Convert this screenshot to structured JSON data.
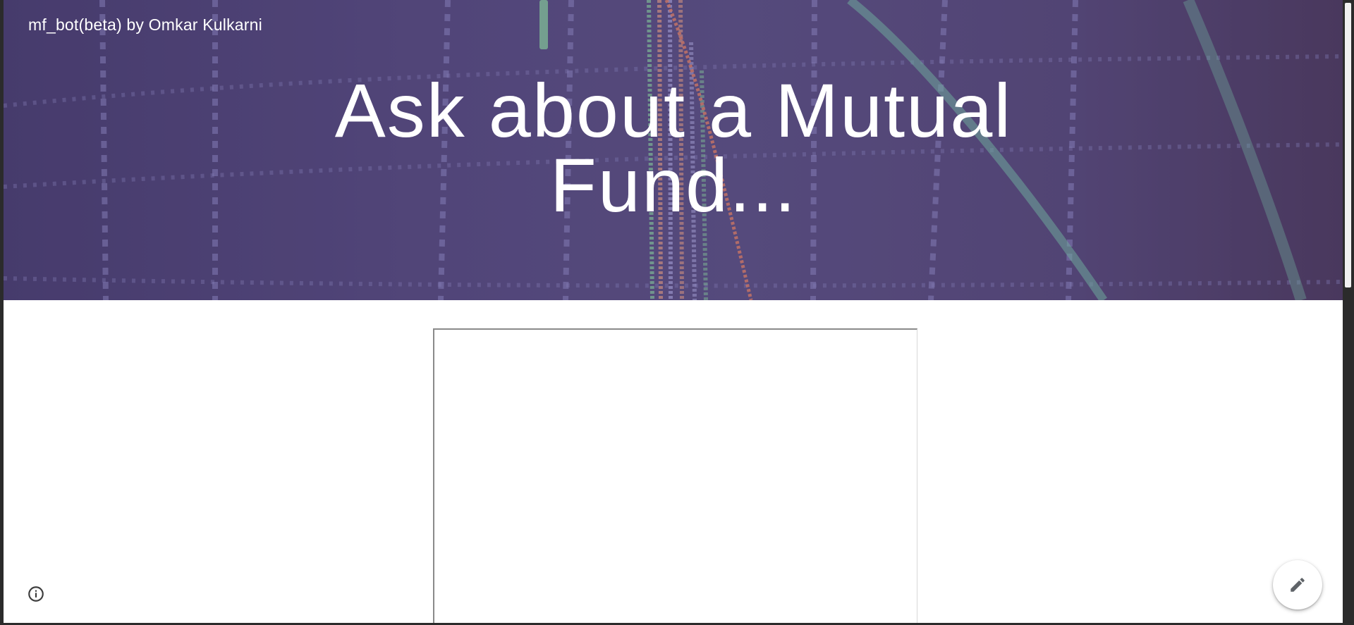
{
  "site": {
    "title": "mf_bot(beta) by Omkar Kulkarni"
  },
  "hero": {
    "heading": "Ask about a Mutual Fund..."
  },
  "icons": {
    "info": "info-icon",
    "edit": "pencil-icon"
  },
  "colors": {
    "hero_overlay": "#5e5387",
    "page_background": "#ffffff",
    "window_frame": "#2b2b2b"
  }
}
